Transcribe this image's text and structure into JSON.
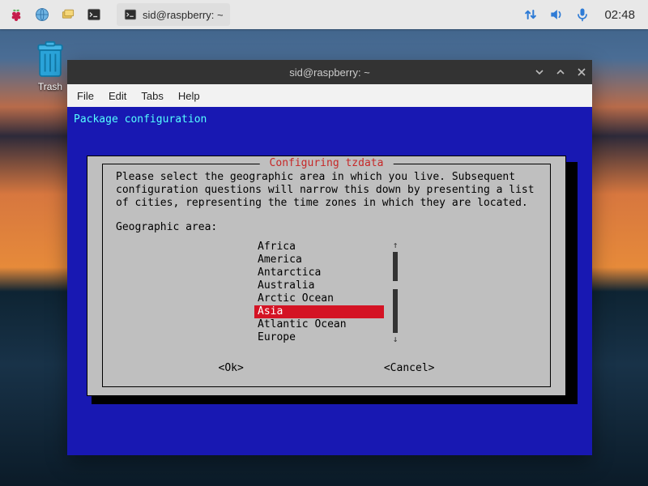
{
  "panel": {
    "task_label": "sid@raspberry: ~",
    "clock": "02:48"
  },
  "desktop": {
    "trash_label": "Trash"
  },
  "window": {
    "title": "sid@raspberry: ~",
    "menu": {
      "file": "File",
      "edit": "Edit",
      "tabs": "Tabs",
      "help": "Help"
    }
  },
  "term": {
    "header": "Package configuration"
  },
  "dialog": {
    "title": " Configuring tzdata ",
    "body": "Please select the geographic area in which you live. Subsequent configuration questions will narrow this down by presenting a list of cities, representing the time zones in which they are located.",
    "prompt": "Geographic area:",
    "items": [
      "Africa",
      "America",
      "Antarctica",
      "Australia",
      "Arctic Ocean",
      "Asia",
      "Atlantic Ocean",
      "Europe"
    ],
    "selected_index": 5,
    "ok": "<Ok>",
    "cancel": "<Cancel>"
  }
}
